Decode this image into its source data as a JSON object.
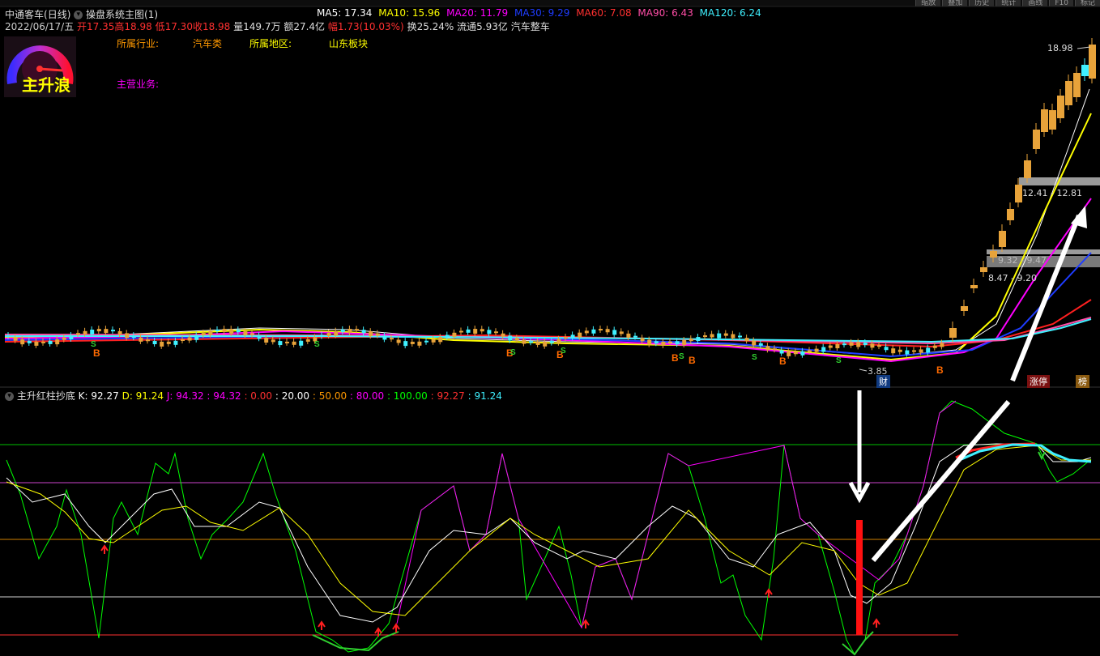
{
  "topbar": {
    "right_buttons": [
      "缩放",
      "叠加",
      "历史",
      "统计",
      "画线",
      "F10",
      "标记"
    ]
  },
  "header": {
    "stock_name": "中通客车",
    "period": "(日线)",
    "indicator_main": "操盘系统主图(1)",
    "ma": [
      {
        "label": "MA5: 17.34",
        "color": "#ffffff"
      },
      {
        "label": "MA10: 15.96",
        "color": "#ffff00"
      },
      {
        "label": "MA20: 11.79",
        "color": "#ff00ff"
      },
      {
        "label": "MA30: 9.29",
        "color": "#1e3cff"
      },
      {
        "label": "MA60: 7.08",
        "color": "#ff3030"
      },
      {
        "label": "MA90: 6.43",
        "color": "#ff4da6"
      },
      {
        "label": "MA120: 6.24",
        "color": "#3ff0ff"
      }
    ],
    "date": "2022/06/17/五",
    "open": "开17.35",
    "high": "高18.98",
    "low": "低17.30",
    "close": "收18.98",
    "volume": "量149.7万",
    "amount": "额27.4亿",
    "change": "幅1.73(10.03%)",
    "turnover": "换25.24%",
    "float_cap": "流通5.93亿",
    "concept": "汽车整车"
  },
  "info": {
    "industry_label": "所属行业:",
    "industry_value": "汽车类",
    "region_label": "所属地区:",
    "region_value": "山东板块",
    "business_label": "主营业务:"
  },
  "gauge": {
    "label": "主升浪"
  },
  "price_chart": {
    "high_label": "18.98",
    "low_label": "3.85",
    "zone_labels": [
      "12.41 - 12.81",
      "9.32 - 9.47",
      "8.47 - 9.20"
    ],
    "badges": {
      "cai": "财",
      "zhangting": "涨停",
      "bang": "榜"
    },
    "signal_b": "B",
    "signal_s": "S",
    "colors": {
      "up": "#e8a33a",
      "down": "#3ff0ff"
    }
  },
  "sub_chart": {
    "title": "主升红柱抄底",
    "values": [
      {
        "label": "K: 92.27",
        "color": "#ffffff"
      },
      {
        "label": "D: 91.24",
        "color": "#ffff00"
      },
      {
        "label": "J: 94.32",
        "color": "#ff00ff"
      },
      {
        "label": ": 94.32",
        "color": "#ff00ff"
      },
      {
        "label": ": 0.00",
        "color": "#ff3030"
      },
      {
        "label": ": 20.00",
        "color": "#ffffff"
      },
      {
        "label": ": 50.00",
        "color": "#ff9900"
      },
      {
        "label": ": 80.00",
        "color": "#ff00ff"
      },
      {
        "label": ": 100.00",
        "color": "#00ff00"
      },
      {
        "label": ": 92.27",
        "color": "#ff3030"
      },
      {
        "label": ": 91.24",
        "color": "#3ff0ff"
      }
    ]
  }
}
